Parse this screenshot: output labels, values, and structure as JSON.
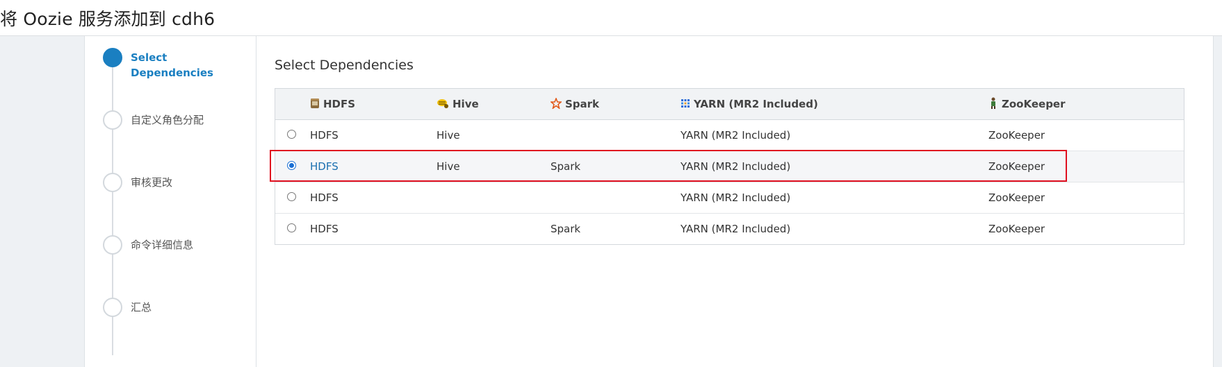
{
  "page": {
    "title": "将 Oozie 服务添加到 cdh6"
  },
  "wizard": {
    "steps": [
      {
        "label": "Select Dependencies",
        "active": true
      },
      {
        "label": "自定义角色分配",
        "active": false
      },
      {
        "label": "审核更改",
        "active": false
      },
      {
        "label": "命令详细信息",
        "active": false
      },
      {
        "label": "汇总",
        "active": false
      }
    ]
  },
  "main": {
    "title": "Select Dependencies",
    "table": {
      "headers": {
        "hdfs": "HDFS",
        "hive": "Hive",
        "spark": "Spark",
        "yarn": "YARN (MR2 Included)",
        "zookeeper": "ZooKeeper"
      },
      "header_icons": {
        "hdfs": "hdfs-icon",
        "hive": "hive-icon",
        "spark": "spark-icon",
        "yarn": "yarn-icon",
        "zookeeper": "zookeeper-icon"
      },
      "rows": [
        {
          "selected": false,
          "hdfs": "HDFS",
          "hive": "Hive",
          "spark": "",
          "yarn": "YARN (MR2 Included)",
          "zookeeper": "ZooKeeper"
        },
        {
          "selected": true,
          "hdfs": "HDFS",
          "hive": "Hive",
          "spark": "Spark",
          "yarn": "YARN (MR2 Included)",
          "zookeeper": "ZooKeeper"
        },
        {
          "selected": false,
          "hdfs": "HDFS",
          "hive": "",
          "spark": "",
          "yarn": "YARN (MR2 Included)",
          "zookeeper": "ZooKeeper"
        },
        {
          "selected": false,
          "hdfs": "HDFS",
          "hive": "",
          "spark": "Spark",
          "yarn": "YARN (MR2 Included)",
          "zookeeper": "ZooKeeper"
        }
      ]
    }
  },
  "colors": {
    "accent": "#1a7fc1",
    "highlight_border": "#e00f1f",
    "gutter_bg": "#eef1f4"
  }
}
